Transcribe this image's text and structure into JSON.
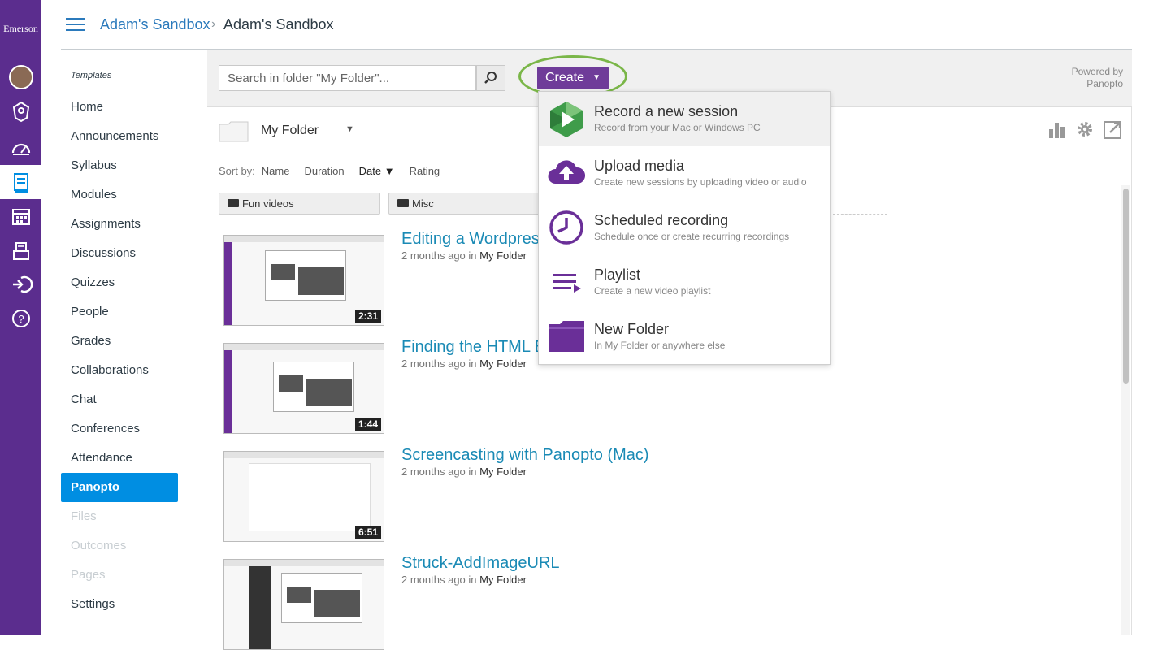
{
  "global_nav": {
    "brand": "Emerson",
    "items": [
      "avatar",
      "account-badge-icon",
      "dashboard-icon",
      "courses-icon",
      "calendar-icon",
      "inbox-icon",
      "commons-icon",
      "help-icon"
    ]
  },
  "breadcrumb": {
    "link": "Adam's Sandbox",
    "separator": "›",
    "current": "Adam's Sandbox"
  },
  "course_nav": {
    "templates_label": "Templates",
    "items": [
      {
        "label": "Home",
        "state": "normal"
      },
      {
        "label": "Announcements",
        "state": "normal"
      },
      {
        "label": "Syllabus",
        "state": "normal"
      },
      {
        "label": "Modules",
        "state": "normal"
      },
      {
        "label": "Assignments",
        "state": "normal"
      },
      {
        "label": "Discussions",
        "state": "normal"
      },
      {
        "label": "Quizzes",
        "state": "normal"
      },
      {
        "label": "People",
        "state": "normal"
      },
      {
        "label": "Grades",
        "state": "normal"
      },
      {
        "label": "Collaborations",
        "state": "normal"
      },
      {
        "label": "Chat",
        "state": "normal"
      },
      {
        "label": "Conferences",
        "state": "normal"
      },
      {
        "label": "Attendance",
        "state": "normal"
      },
      {
        "label": "Panopto",
        "state": "active"
      },
      {
        "label": "Files",
        "state": "disabled"
      },
      {
        "label": "Outcomes",
        "state": "disabled"
      },
      {
        "label": "Pages",
        "state": "disabled"
      },
      {
        "label": "Settings",
        "state": "normal"
      }
    ]
  },
  "panopto": {
    "search": {
      "placeholder": "Search in folder \"My Folder\"..."
    },
    "create_label": "Create",
    "create_caret": "▼",
    "powered_by": "Powered by",
    "powered_by_brand": "Panopto",
    "folder_name": "My Folder",
    "folder_caret": "▼",
    "sort": {
      "label": "Sort by:",
      "options": [
        "Name",
        "Duration",
        "Date ▼",
        "Rating"
      ],
      "selected": "Date ▼"
    },
    "subfolders": [
      "Fun videos",
      "Misc"
    ],
    "sessions": [
      {
        "title": "Editing a Wordpress",
        "age": "2 months ago",
        "in_label": "in",
        "folder": "My Folder",
        "duration": "2:31"
      },
      {
        "title": "Finding the HTML E",
        "age": "2 months ago",
        "in_label": "in",
        "folder": "My Folder",
        "duration": "1:44"
      },
      {
        "title": "Screencasting with Panopto (Mac)",
        "age": "2 months ago",
        "in_label": "in",
        "folder": "My Folder",
        "duration": "6:51"
      },
      {
        "title": "Struck-AddImageURL",
        "age": "2 months ago",
        "in_label": "in",
        "folder": "My Folder",
        "duration": ""
      }
    ],
    "create_menu": [
      {
        "title": "Record a new session",
        "subtitle": "Record from your Mac or Windows PC",
        "icon": "panopto-logo-icon"
      },
      {
        "title": "Upload media",
        "subtitle": "Create new sessions by uploading video or audio",
        "icon": "cloud-upload-icon"
      },
      {
        "title": "Scheduled recording",
        "subtitle": "Schedule once or create recurring recordings",
        "icon": "clock-icon"
      },
      {
        "title": "Playlist",
        "subtitle": "Create a new video playlist",
        "icon": "playlist-icon"
      },
      {
        "title": "New Folder",
        "subtitle": "In My Folder or anywhere else",
        "icon": "folder-icon"
      }
    ]
  },
  "colors": {
    "global_nav": "#5b2d8e",
    "link": "#2b7abc",
    "active_nav": "#008ee2",
    "create_button": "#6f3c99",
    "highlight_ring": "#7ab648",
    "session_title": "#1a8ab5",
    "menu_icon": "#6a2f98"
  }
}
